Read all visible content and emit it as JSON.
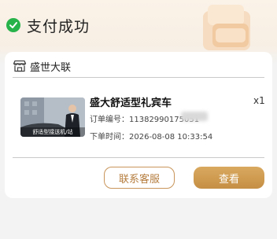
{
  "header": {
    "title": "支付成功",
    "icon": "check-circle-icon",
    "accent": "#27b24a"
  },
  "store": {
    "icon": "store-icon",
    "name": "盛世大联"
  },
  "order": {
    "product_title": "盛大舒适型礼宾车",
    "quantity": "x1",
    "image_caption": "舒适型接送机/站",
    "order_number_label": "订单编号：",
    "order_number_value": "11382990175051",
    "order_time_label": "下单时间：",
    "order_time_value": "2026-08-08 10:33:54"
  },
  "actions": {
    "contact_label": "联系客服",
    "view_label": "查看",
    "brand_color": "#c9955a"
  }
}
